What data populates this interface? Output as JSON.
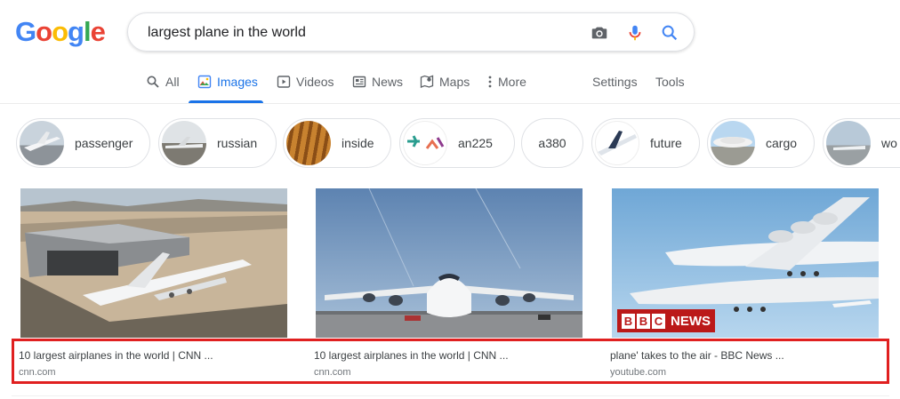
{
  "logo": {
    "letters": [
      "G",
      "o",
      "o",
      "g",
      "l",
      "e"
    ],
    "colors": [
      "#4285f4",
      "#ea4335",
      "#fbbc05",
      "#4285f4",
      "#34a853",
      "#ea4335"
    ]
  },
  "search": {
    "query": "largest plane in the world"
  },
  "tabs": [
    {
      "label": "All",
      "icon": "search-icon"
    },
    {
      "label": "Images",
      "icon": "image-icon"
    },
    {
      "label": "Videos",
      "icon": "play-icon"
    },
    {
      "label": "News",
      "icon": "newspaper-icon"
    },
    {
      "label": "Maps",
      "icon": "map-pin-icon"
    },
    {
      "label": "More",
      "icon": "more-vert-icon"
    }
  ],
  "tools": {
    "settings": "Settings",
    "tools": "Tools"
  },
  "chips": [
    {
      "label": "passenger"
    },
    {
      "label": "russian"
    },
    {
      "label": "inside"
    },
    {
      "label": "an225"
    },
    {
      "label": "a380"
    },
    {
      "label": "future"
    },
    {
      "label": "cargo"
    },
    {
      "label": "wo"
    }
  ],
  "results": [
    {
      "title": "10 largest airplanes in the world | CNN ...",
      "source": "cnn.com"
    },
    {
      "title": "10 largest airplanes in the world | CNN ...",
      "source": "cnn.com"
    },
    {
      "title": "plane' takes to the air - BBC News ...",
      "source": "youtube.com"
    }
  ],
  "bbc_badge": {
    "letters": [
      "B",
      "B",
      "C"
    ],
    "word": "NEWS"
  },
  "colors": {
    "accent": "#1a73e8",
    "highlight": "#e02020",
    "bbc_red": "#bb1919"
  }
}
